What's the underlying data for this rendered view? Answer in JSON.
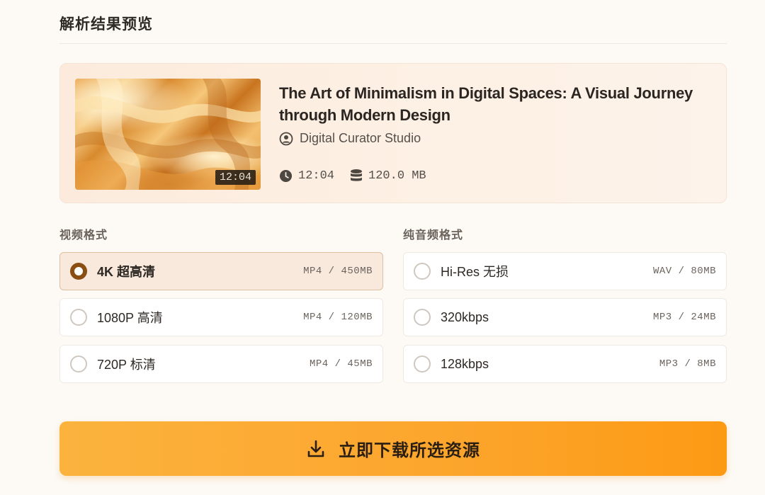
{
  "section": {
    "title": "解析结果预览"
  },
  "media": {
    "title": "The Art of Minimalism in Digital Spaces: A Visual Journey through Modern Design",
    "author": "Digital Curator Studio",
    "thumbnail_duration": "12:04",
    "duration": "12:04",
    "size": "120.0 MB",
    "icons": {
      "author": "user-circle-icon",
      "duration": "clock-icon",
      "size": "database-icon"
    }
  },
  "video_formats": {
    "label": "视频格式",
    "options": [
      {
        "label": "4K 超高清",
        "spec": "MP4 / 450MB",
        "selected": true
      },
      {
        "label": "1080P 高清",
        "spec": "MP4 / 120MB",
        "selected": false
      },
      {
        "label": "720P 标清",
        "spec": "MP4 / 45MB",
        "selected": false
      }
    ]
  },
  "audio_formats": {
    "label": "纯音频格式",
    "options": [
      {
        "label": "Hi-Res 无损",
        "spec": "WAV / 80MB",
        "selected": false
      },
      {
        "label": "320kbps",
        "spec": "MP3 / 24MB",
        "selected": false
      },
      {
        "label": "128kbps",
        "spec": "MP3 / 8MB",
        "selected": false
      }
    ]
  },
  "download": {
    "label": "立即下载所选资源",
    "icon": "download-icon"
  },
  "colors": {
    "accent": "#fca52c",
    "selected_radio": "#8a4d12",
    "selected_bg": "#f8e9dc",
    "card_bg": "#fcebdc"
  }
}
